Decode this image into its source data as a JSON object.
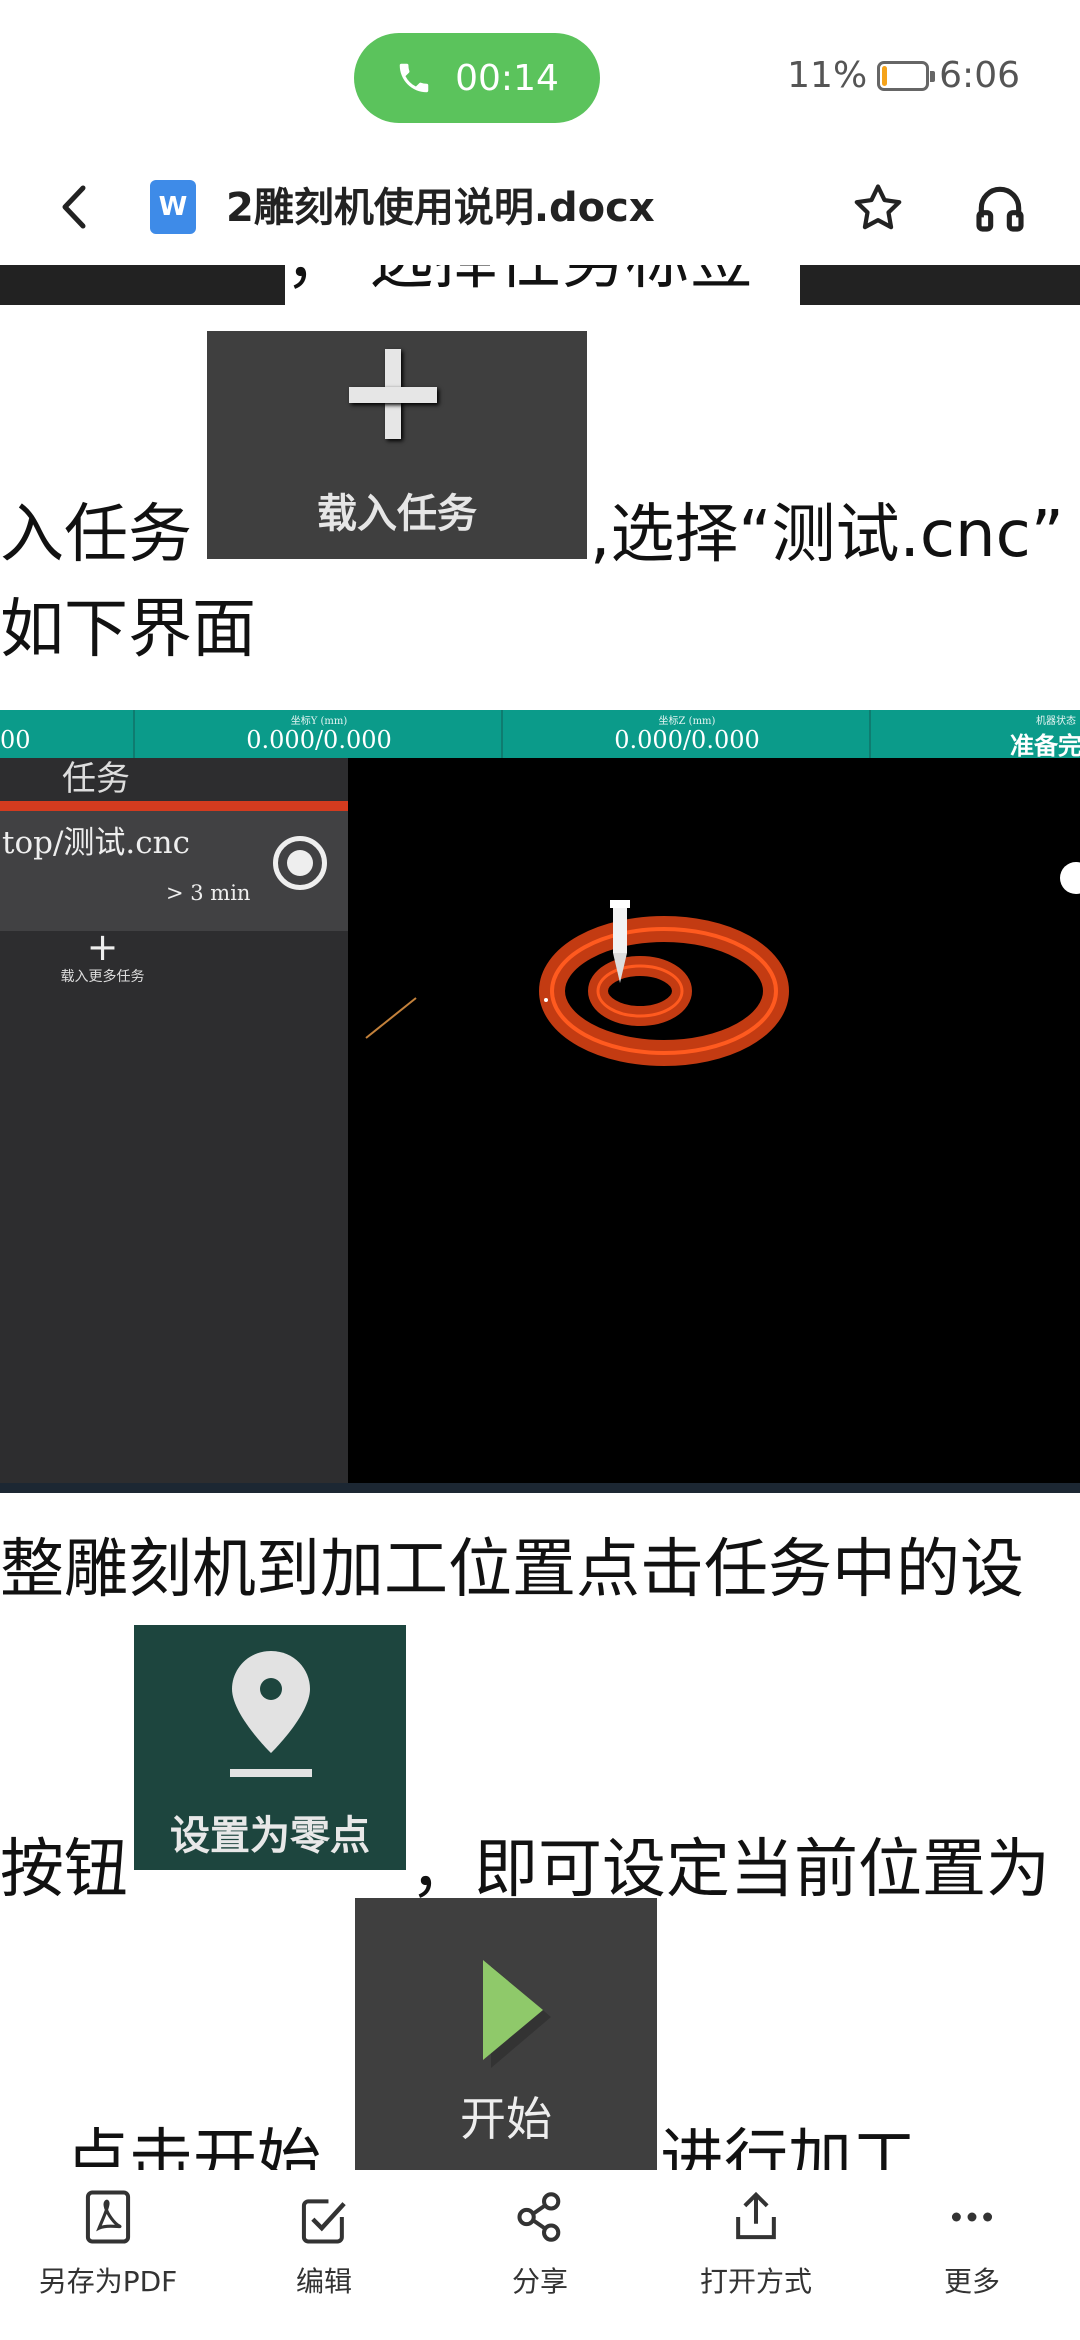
{
  "status_bar": {
    "call_time": "00:14",
    "battery": "11%",
    "battery_level": 0.11,
    "time": "6:06"
  },
  "title_bar": {
    "doc_icon": "W",
    "title": "2雕刻机使用说明.docx"
  },
  "doc": {
    "line_top": "，  选择任务标签",
    "load_line": "入任务",
    "load_img_label": "载入任务",
    "load_line_after": ",选择“测试.cnc”",
    "load_line2": "如下界面",
    "screenshot": {
      "col0_value": "00",
      "col1_caption": "坐标Y (mm)",
      "col1_value": "0.000/0.000",
      "col2_caption": "坐标Z (mm)",
      "col2_value": "0.000/0.000",
      "col3_caption": "机器状态",
      "col3_value": "准备完",
      "sidebar_title": "任务",
      "task_name": "top/测试.cnc",
      "task_time": "> 3 min",
      "more_tasks": "载入更多任务"
    },
    "line_adjust": "整雕刻机到加工位置点击任务中的设",
    "zero_prefix": "按钮",
    "zero_img_label": "设置为零点",
    "zero_suffix": "，即可设定当前位置为",
    "start_prefix": "点击开始",
    "start_img_label": "开始",
    "start_suffix": "进行加工"
  },
  "toolbar": [
    {
      "label": "另存为PDF",
      "icon": "pdf-icon"
    },
    {
      "label": "编辑",
      "icon": "edit-icon"
    },
    {
      "label": "分享",
      "icon": "share-icon"
    },
    {
      "label": "打开方式",
      "icon": "open-with-icon"
    },
    {
      "label": "更多",
      "icon": "more-icon"
    }
  ]
}
